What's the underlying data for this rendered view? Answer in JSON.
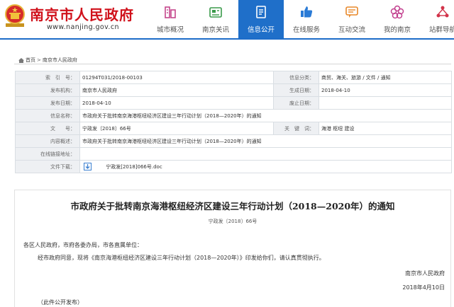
{
  "site": {
    "title": "南京市人民政府",
    "url": "www.nanjing.gov.cn"
  },
  "nav": {
    "items": [
      {
        "label": "城市概况",
        "icon": "building-icon",
        "color": "#c5468c"
      },
      {
        "label": "南京关讯",
        "icon": "news-icon",
        "color": "#3a9a4a"
      },
      {
        "label": "信息公开",
        "icon": "document-icon",
        "color": "#ffffff",
        "active": true
      },
      {
        "label": "在线服务",
        "icon": "thumbs-up-icon",
        "color": "#2b7bd6"
      },
      {
        "label": "互动交流",
        "icon": "chat-icon",
        "color": "#e8882a"
      },
      {
        "label": "我的南京",
        "icon": "flower-icon",
        "color": "#c23f8e"
      },
      {
        "label": "站群导航",
        "icon": "network-icon",
        "color": "#d2334a"
      }
    ]
  },
  "breadcrumb": {
    "home": "首页",
    "current": "南京市人民政府"
  },
  "info": {
    "index_label": "索　引　号：",
    "index_value": "01294T031/2018-00103",
    "category_label": "信息分类：",
    "category_value": "商贸、海关、旅游 / 文件 / 通知",
    "issuer_label": "发布机构：",
    "issuer_value": "南京市人民政府",
    "created_label": "生成日期：",
    "created_value": "2018-04-10",
    "publish_label": "发布日期：",
    "publish_value": "2018-04-10",
    "abolish_label": "废止日期：",
    "abolish_value": "",
    "name_label": "信息名称：",
    "name_value": "市政府关于批转南京海港枢纽经济区建设三年行动计划（2018—2020年）的通知",
    "docno_label": "文　　号：",
    "docno_value": "宁政发〔2018〕66号",
    "keywords_label": "关　键　词：",
    "keywords_value": "海港 枢纽 建设",
    "summary_label": "内容概述：",
    "summary_value": "市政府关于批转南京海港枢纽经济区建设三年行动计划（2018—2020年）的通知",
    "link_label": "在线链接地址：",
    "link_value": "",
    "download_label": "文件下载：",
    "download_file": "宁政发[2018]066号.doc"
  },
  "article": {
    "title": "市政府关于批转南京海港枢纽经济区建设三年行动计划（2018—2020年）的通知",
    "doc_no": "宁政发〔2018〕66号",
    "addressees": "各区人民政府，市府各委办局，市各直属单位：",
    "body": "经市政府同意，现将《南京海港枢纽经济区建设三年行动计划（2018—2020年）》印发给你们，请认真贯彻执行。",
    "signer": "南京市人民政府",
    "date": "2018年4月10日",
    "note": "（此件公开发布）"
  },
  "colors": {
    "brand_red": "#d0111b",
    "nav_active": "#1f6fc9",
    "label_bg": "#eef0f3"
  }
}
